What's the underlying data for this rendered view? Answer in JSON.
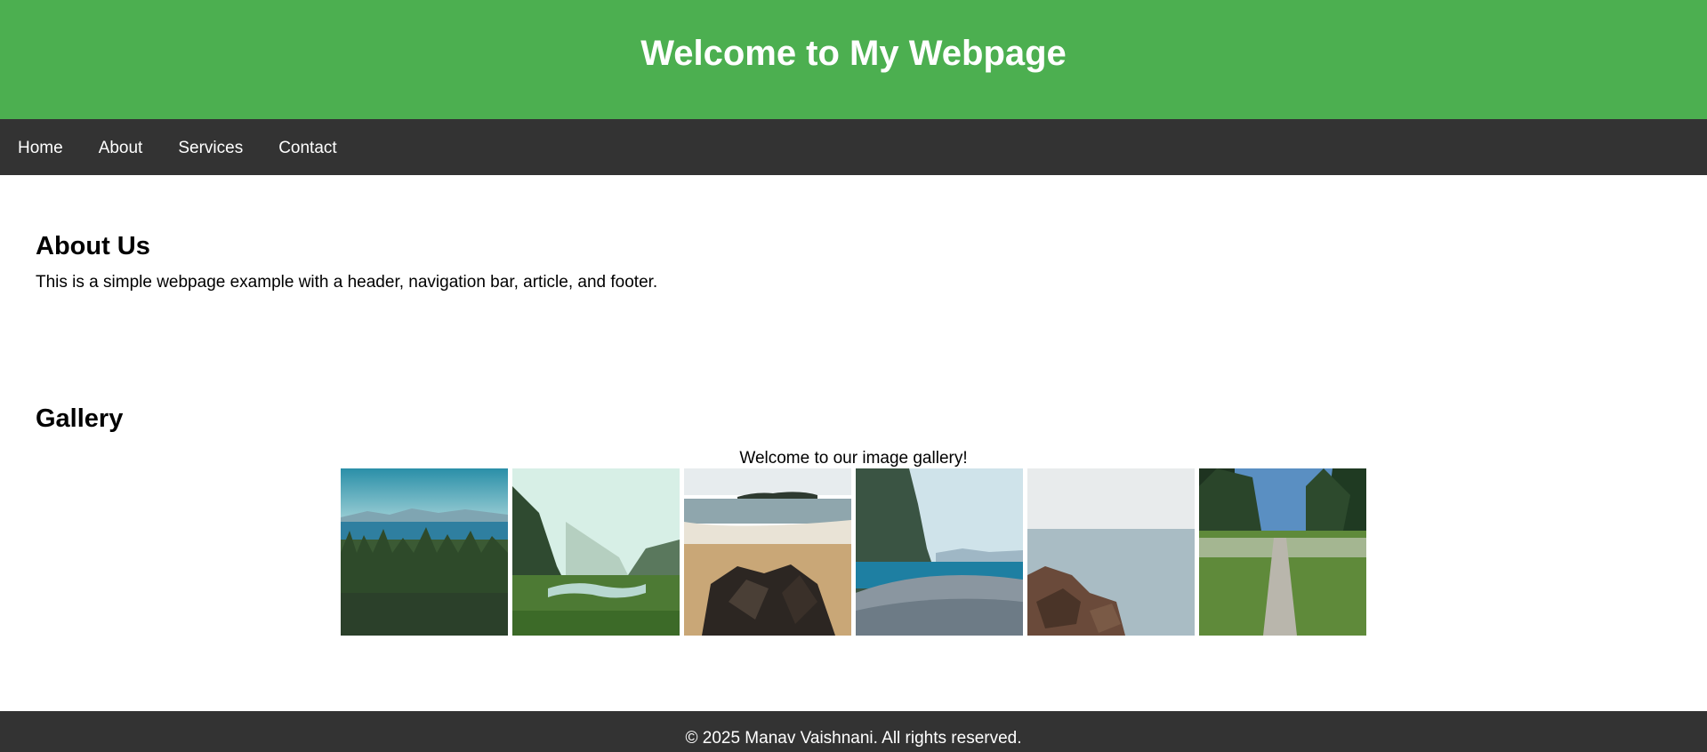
{
  "header": {
    "title": "Welcome to My Webpage",
    "color": "#4caf50"
  },
  "nav": {
    "items": [
      {
        "label": "Home"
      },
      {
        "label": "About"
      },
      {
        "label": "Services"
      },
      {
        "label": "Contact"
      }
    ]
  },
  "about": {
    "title": "About Us",
    "text": "This is a simple webpage example with a header, navigation bar, article, and footer."
  },
  "gallery": {
    "title": "Gallery",
    "intro": "Welcome to our image gallery!",
    "images": [
      {
        "name": "forest-lake-mountains-photo"
      },
      {
        "name": "misty-valley-stream-photo"
      },
      {
        "name": "beach-rocks-photo"
      },
      {
        "name": "pebble-shore-photo"
      },
      {
        "name": "rocky-coast-photo"
      },
      {
        "name": "forest-path-photo"
      }
    ]
  },
  "footer": {
    "text": "© 2025 Manav Vaishnani. All rights reserved."
  }
}
